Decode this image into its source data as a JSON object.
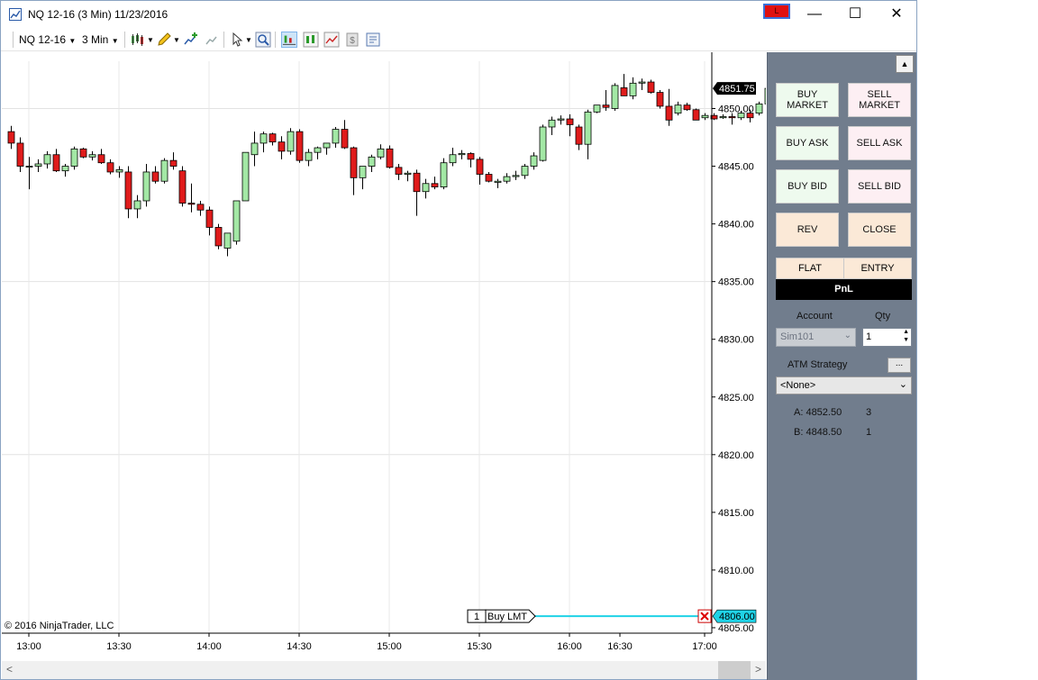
{
  "window": {
    "title": "NQ 12-16 (3 Min)  11/23/2016",
    "account_badge": "L",
    "minimize": "—",
    "maximize": "☐",
    "close": "✕"
  },
  "toolbar": {
    "instrument": "NQ 12-16",
    "interval": "3 Min"
  },
  "chart": {
    "copyright": "© 2016 NinjaTrader, LLC",
    "order_label_qty": "1",
    "order_label_type": "Buy LMT",
    "order_price": "4806.00",
    "last_price": "4851.75",
    "colors": {
      "up": "#a3e8a5",
      "down": "#e01b1b",
      "order_line": "#1fd2e6"
    }
  },
  "chart_data": {
    "type": "candlestick",
    "instrument": "NQ 12-16",
    "interval": "3 Min",
    "ylim": [
      4804,
      4857
    ],
    "y_ticks": [
      4805,
      4810,
      4815,
      4820,
      4825,
      4830,
      4835,
      4840,
      4845,
      4850
    ],
    "x_tick_labels": [
      "13:00",
      "13:30",
      "14:00",
      "14:30",
      "15:00",
      "15:30",
      "16:00",
      "16:30",
      "17:00"
    ],
    "candles": [
      [
        4848,
        4848.5,
        4846.5,
        4847
      ],
      [
        4847,
        4847.5,
        4844.5,
        4845
      ],
      [
        4845,
        4845.8,
        4843,
        4845
      ],
      [
        4845,
        4845.6,
        4844.5,
        4845.2
      ],
      [
        4845.2,
        4846.3,
        4844.8,
        4846
      ],
      [
        4846,
        4846.5,
        4844.5,
        4844.6
      ],
      [
        4844.6,
        4845.2,
        4844.1,
        4845
      ],
      [
        4845,
        4846.7,
        4844.7,
        4846.5
      ],
      [
        4846.5,
        4846.6,
        4845.7,
        4845.8
      ],
      [
        4845.8,
        4846.3,
        4845.5,
        4846
      ],
      [
        4846,
        4846.5,
        4845.2,
        4845.3
      ],
      [
        4845.3,
        4845.6,
        4844.3,
        4844.5
      ],
      [
        4844.5,
        4845,
        4844,
        4844.7
      ],
      [
        4844.5,
        4845,
        4840.5,
        4841.3
      ],
      [
        4841.3,
        4842.5,
        4840.5,
        4842
      ],
      [
        4842,
        4845.2,
        4841.5,
        4844.5
      ],
      [
        4844.5,
        4845,
        4843.5,
        4843.7
      ],
      [
        4843.7,
        4845.7,
        4843.5,
        4845.5
      ],
      [
        4845.5,
        4846.2,
        4844.7,
        4845
      ],
      [
        4844.6,
        4845,
        4841.5,
        4841.8
      ],
      [
        4841.8,
        4843.5,
        4841,
        4841.7
      ],
      [
        4841.7,
        4842,
        4840.7,
        4841.2
      ],
      [
        4841.2,
        4841.5,
        4839,
        4839.7
      ],
      [
        4839.7,
        4840,
        4837.8,
        4838.1
      ],
      [
        4837.9,
        4838.3,
        4837.2,
        4839.2
      ],
      [
        4838.5,
        4842,
        4838.2,
        4842
      ],
      [
        4842,
        4846.2,
        4842,
        4846.2
      ],
      [
        4846,
        4848,
        4845,
        4847
      ],
      [
        4847,
        4848,
        4846.2,
        4847.8
      ],
      [
        4847.8,
        4847.9,
        4846.8,
        4847.1
      ],
      [
        4847.1,
        4847.6,
        4845.6,
        4846.3
      ],
      [
        4846.3,
        4848.3,
        4846,
        4848
      ],
      [
        4848,
        4848.2,
        4845.3,
        4845.5
      ],
      [
        4845.5,
        4846.5,
        4845,
        4846.2
      ],
      [
        4846.2,
        4846.7,
        4845.6,
        4846.6
      ],
      [
        4846.6,
        4847,
        4846,
        4847
      ],
      [
        4847,
        4848.4,
        4846.6,
        4848.2
      ],
      [
        4848.2,
        4849,
        4846.5,
        4846.6
      ],
      [
        4846.6,
        4846.7,
        4842.5,
        4844
      ],
      [
        4844,
        4845,
        4843,
        4845
      ],
      [
        4845,
        4846,
        4844.5,
        4845.8
      ],
      [
        4845.8,
        4846.9,
        4845.6,
        4846.5
      ],
      [
        4846.5,
        4846.8,
        4844.8,
        4844.9
      ],
      [
        4844.9,
        4845.2,
        4843.8,
        4844.3
      ],
      [
        4844.3,
        4844.6,
        4843.7,
        4844.4
      ],
      [
        4844.4,
        4844.7,
        4840.7,
        4842.8
      ],
      [
        4842.8,
        4843.9,
        4842.2,
        4843.5
      ],
      [
        4843.5,
        4844.1,
        4843,
        4843.2
      ],
      [
        4843.2,
        4845.7,
        4843,
        4845.3
      ],
      [
        4845.3,
        4846.6,
        4845,
        4846
      ],
      [
        4846,
        4846.4,
        4845.6,
        4846.1
      ],
      [
        4846.1,
        4846.2,
        4844.9,
        4845.6
      ],
      [
        4845.6,
        4845.8,
        4843.4,
        4844.3
      ],
      [
        4844.3,
        4844.5,
        4843.6,
        4843.7
      ],
      [
        4843.6,
        4843.9,
        4843.1,
        4843.7
      ],
      [
        4843.7,
        4844.4,
        4843.5,
        4844.1
      ],
      [
        4844.1,
        4844.6,
        4843.8,
        4844.2
      ],
      [
        4844.2,
        4845.2,
        4843.9,
        4845
      ],
      [
        4845,
        4846.2,
        4844.7,
        4845.9
      ],
      [
        4845.5,
        4848.6,
        4845.4,
        4848.4
      ],
      [
        4848.4,
        4849.3,
        4847.7,
        4849
      ],
      [
        4849,
        4849.4,
        4848.6,
        4849.1
      ],
      [
        4849.1,
        4849.5,
        4847.6,
        4848.6
      ],
      [
        4848.4,
        4848.6,
        4846.4,
        4846.9
      ],
      [
        4846.9,
        4849.9,
        4845.6,
        4849.7
      ],
      [
        4849.7,
        4850.3,
        4849.6,
        4850.3
      ],
      [
        4850.3,
        4851.6,
        4849.8,
        4850.1
      ],
      [
        4850,
        4852.2,
        4849.8,
        4852
      ],
      [
        4851.8,
        4853,
        4851.3,
        4851.1
      ],
      [
        4851.1,
        4852.7,
        4850.8,
        4852.2
      ],
      [
        4852.2,
        4852.6,
        4851.6,
        4852.3
      ],
      [
        4852.3,
        4852.5,
        4851.3,
        4851.4
      ],
      [
        4851.4,
        4851.6,
        4850,
        4850.2
      ],
      [
        4850.2,
        4851.7,
        4848.5,
        4849
      ],
      [
        4849.6,
        4850.6,
        4849.4,
        4850.3
      ],
      [
        4850.3,
        4850.5,
        4849.8,
        4849.9
      ],
      [
        4849.9,
        4850,
        4849.1,
        4849
      ],
      [
        4849.2,
        4849.6,
        4849,
        4849.4
      ],
      [
        4849.4,
        4849.6,
        4849,
        4849.1
      ],
      [
        4849.2,
        4849.5,
        4849.1,
        4849.3
      ],
      [
        4849.3,
        4849.6,
        4848.6,
        4849.2
      ],
      [
        4849.2,
        4849.8,
        4849,
        4849.6
      ],
      [
        4849.6,
        4849.9,
        4848.8,
        4849.2
      ],
      [
        4849.6,
        4850.6,
        4849.4,
        4850.4
      ],
      [
        4850.4,
        4852,
        4850.2,
        4851.75
      ]
    ]
  },
  "panel": {
    "buy_market": "BUY\nMARKET",
    "sell_market": "SELL\nMARKET",
    "buy_ask": "BUY ASK",
    "sell_ask": "SELL ASK",
    "buy_bid": "BUY BID",
    "sell_bid": "SELL BID",
    "rev": "REV",
    "close": "CLOSE",
    "flat": "FLAT",
    "entry": "ENTRY",
    "pnl": "PnL",
    "account_label": "Account",
    "qty_label": "Qty",
    "account_value": "Sim101",
    "qty_value": "1",
    "atm_label": "ATM Strategy",
    "atm_more": "...",
    "atm_value": "<None>",
    "ask_label": "A: 4852.50",
    "ask_size": "3",
    "bid_label": "B: 4848.50",
    "bid_size": "1"
  }
}
